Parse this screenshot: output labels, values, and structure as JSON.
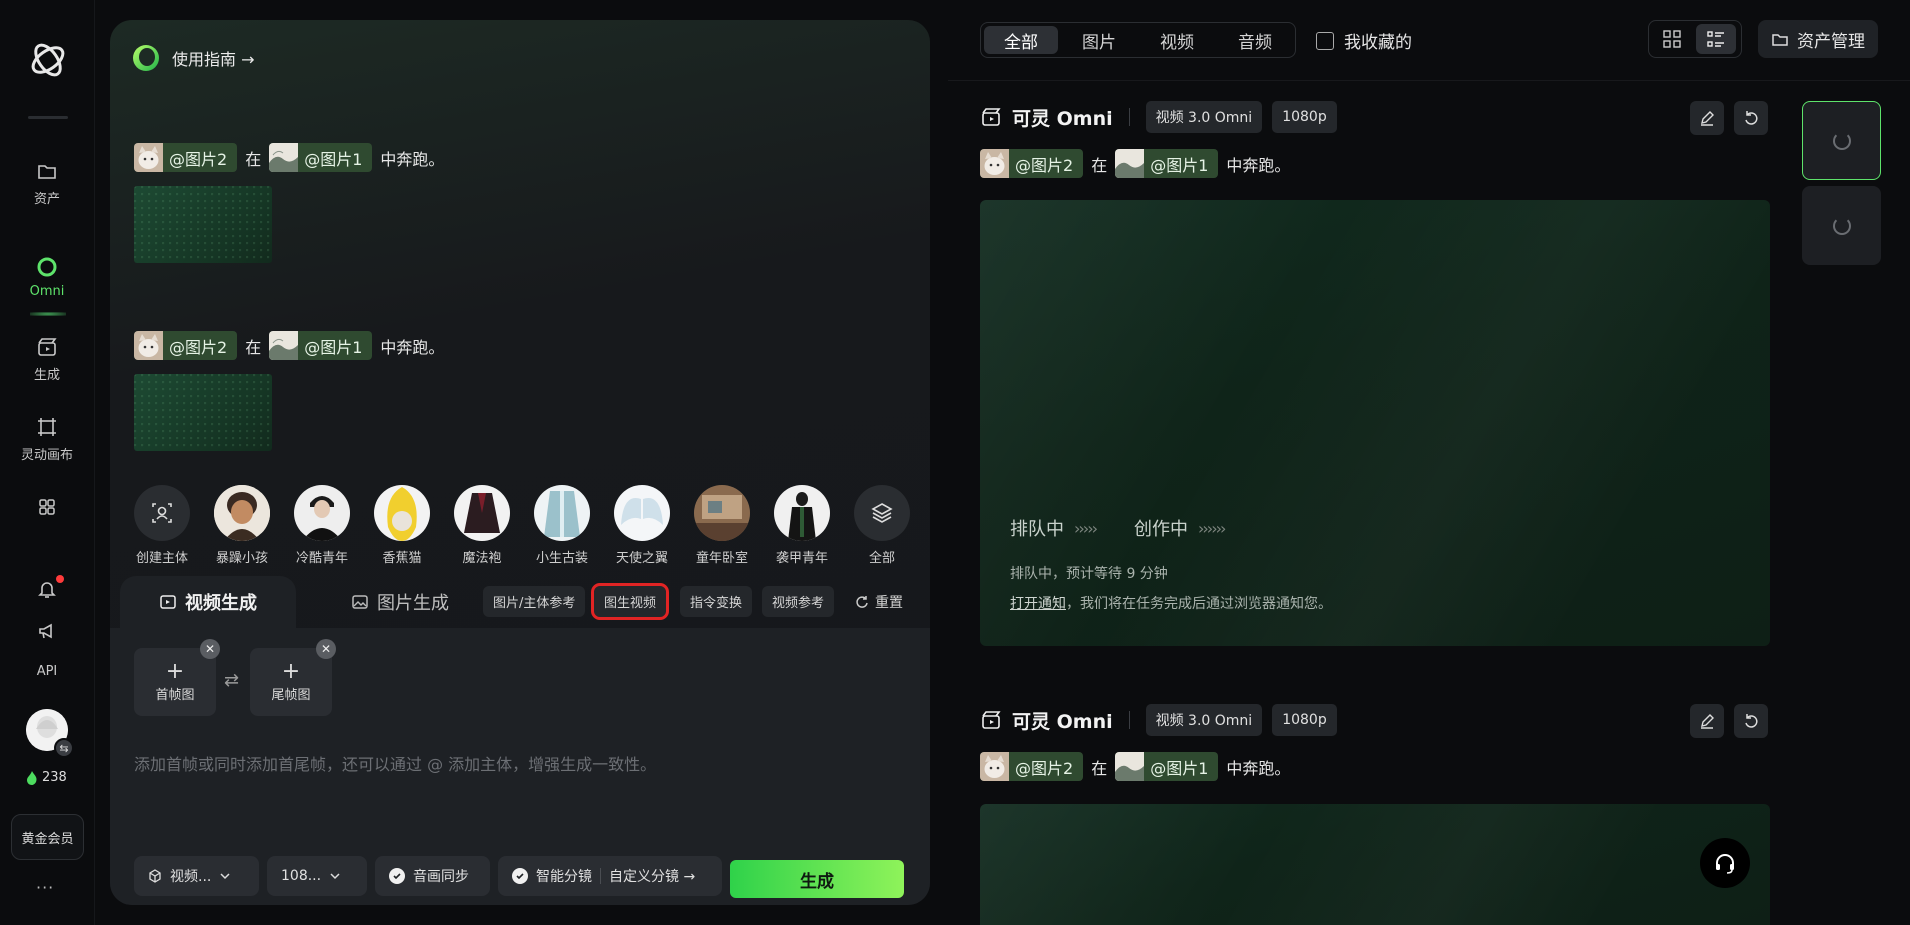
{
  "rail": {
    "items": [
      {
        "label": "资产",
        "icon": "folder-icon"
      },
      {
        "label": "Omni",
        "icon": "omni-logo-icon",
        "active": true
      },
      {
        "label": "生成",
        "icon": "clapper-icon"
      },
      {
        "label": "灵动画布",
        "icon": "canvas-icon"
      },
      {
        "label": "",
        "icon": "apps-icon"
      }
    ],
    "api_label": "API",
    "credits": "238",
    "vip_label": "黄金会员",
    "more_label": "···"
  },
  "panel": {
    "guide_label": "使用指南 →",
    "messages": [
      {
        "chip1": "@图片2",
        "mid": "在",
        "chip2": "@图片1",
        "tail": "中奔跑。"
      },
      {
        "chip1": "@图片2",
        "mid": "在",
        "chip2": "@图片1",
        "tail": "中奔跑。"
      }
    ],
    "subjects": [
      "创建主体",
      "暴躁小孩",
      "冷酷青年",
      "香蕉猫",
      "魔法袍",
      "小生古装",
      "天使之翼",
      "童年卧室",
      "袭甲青年",
      "全部"
    ],
    "tabs": {
      "video": "视频生成",
      "image": "图片生成"
    },
    "modes": [
      "图片/主体参考",
      "图生视频",
      "指令变换",
      "视频参考"
    ],
    "highlighted_mode": "图生视频",
    "reset_label": "重置",
    "first_frame_label": "首帧图",
    "last_frame_label": "尾帧图",
    "placeholder": "添加首帧或同时添加首尾帧，还可以通过 @ 添加主体，增强生成一致性。",
    "options": {
      "model": "视频...",
      "resolution": "108...",
      "audio_sync": "音画同步",
      "smart_shot": "智能分镜",
      "custom_shot": "自定义分镜 →"
    },
    "generate_label": "生成"
  },
  "right": {
    "filters": [
      "全部",
      "图片",
      "视频",
      "音频"
    ],
    "active_filter": "全部",
    "favorites_label": "我收藏的",
    "asset_manager_label": "资产管理",
    "cards": [
      {
        "title": "可灵 Omni",
        "model_tag": "视频 3.0 Omni",
        "res_tag": "1080p",
        "prompt": {
          "chip1": "@图片2",
          "mid": "在",
          "chip2": "@图片1",
          "tail": "中奔跑。"
        },
        "queue_label": "排队中",
        "queue_chevrons": "›››››",
        "creating_label": "创作中",
        "creating_chevrons": "››››››",
        "eta": "排队中，预计等待 9 分钟",
        "notify_link": "打开通知",
        "notify_rest": "，我们将在任务完成后通过浏览器通知您。"
      },
      {
        "title": "可灵 Omni",
        "model_tag": "视频 3.0 Omni",
        "res_tag": "1080p",
        "prompt": {
          "chip1": "@图片2",
          "mid": "在",
          "chip2": "@图片1",
          "tail": "中奔跑。"
        }
      }
    ]
  },
  "colors": {
    "accent_green": "#5ee36b",
    "generate_start": "#2fd24a",
    "generate_end": "#8ff35a",
    "highlight_red": "#e12424"
  }
}
